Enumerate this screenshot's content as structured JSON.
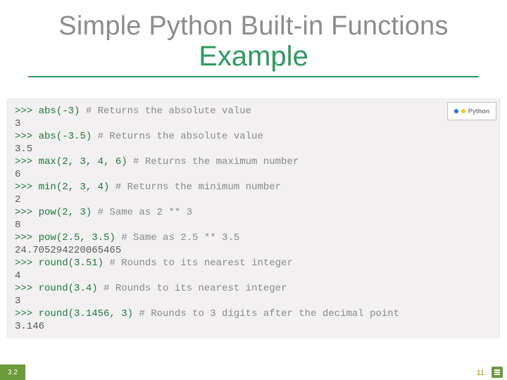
{
  "title": {
    "line1": "Simple Python Built-in Functions",
    "line2": "Example"
  },
  "tag": {
    "label": "Python"
  },
  "code_lines": [
    {
      "kind": "prompt",
      "prompt": ">>>",
      "call": "abs(-3)",
      "comment": "# Returns the absolute value"
    },
    {
      "kind": "output",
      "text": "3"
    },
    {
      "kind": "prompt",
      "prompt": ">>>",
      "call": "abs(-3.5)",
      "comment": "# Returns the absolute value"
    },
    {
      "kind": "output",
      "text": "3.5"
    },
    {
      "kind": "prompt",
      "prompt": ">>>",
      "call": "max(2, 3, 4, 6)",
      "comment": "# Returns the maximum number"
    },
    {
      "kind": "output",
      "text": "6"
    },
    {
      "kind": "prompt",
      "prompt": ">>>",
      "call": "min(2, 3, 4)",
      "comment": "# Returns the minimum number"
    },
    {
      "kind": "output",
      "text": "2"
    },
    {
      "kind": "prompt",
      "prompt": ">>>",
      "call": "pow(2, 3)",
      "comment": "# Same as 2 ** 3"
    },
    {
      "kind": "output",
      "text": "8"
    },
    {
      "kind": "prompt",
      "prompt": ">>>",
      "call": "pow(2.5, 3.5)",
      "comment": "# Same as 2.5 ** 3.5"
    },
    {
      "kind": "output",
      "text": "24.705294220065465"
    },
    {
      "kind": "prompt",
      "prompt": ">>>",
      "call": "round(3.51)",
      "comment": "# Rounds to its nearest integer"
    },
    {
      "kind": "output",
      "text": "4"
    },
    {
      "kind": "prompt",
      "prompt": ">>>",
      "call": "round(3.4)",
      "comment": "# Rounds to its nearest integer"
    },
    {
      "kind": "output",
      "text": "3"
    },
    {
      "kind": "prompt",
      "prompt": ">>>",
      "call": "round(3.1456, 3)",
      "comment": "# Rounds to 3 digits after the decimal point"
    },
    {
      "kind": "output",
      "text": "3.146"
    }
  ],
  "footer": {
    "section": "3.2",
    "page": "11"
  }
}
